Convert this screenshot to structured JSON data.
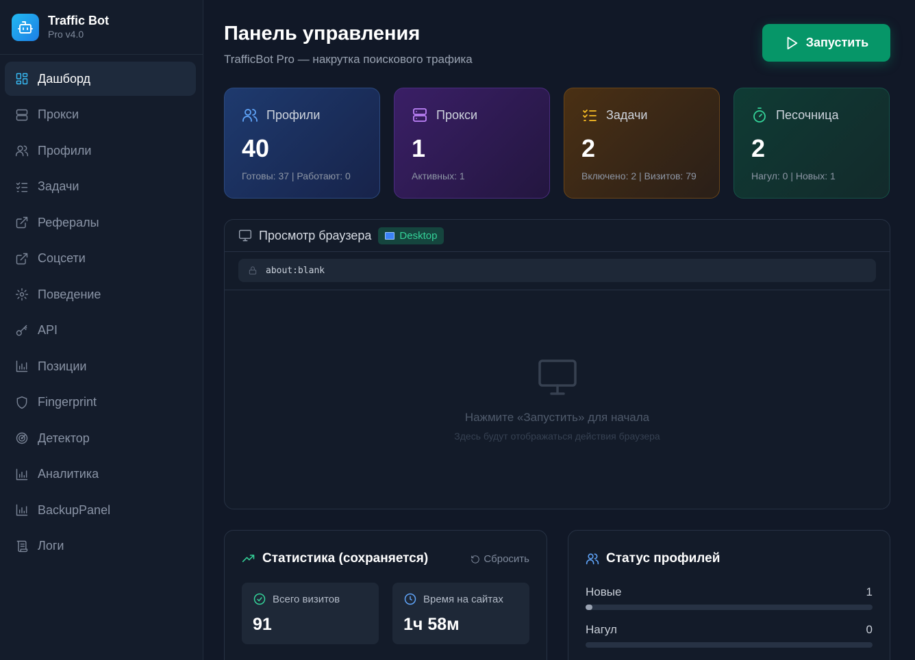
{
  "brand": {
    "title": "Traffic Bot",
    "subtitle": "Pro v4.0"
  },
  "sidebar": {
    "items": [
      {
        "label": "Дашборд",
        "icon": "dashboard-icon",
        "active": true
      },
      {
        "label": "Прокси",
        "icon": "server-icon"
      },
      {
        "label": "Профили",
        "icon": "users-icon"
      },
      {
        "label": "Задачи",
        "icon": "list-checks-icon"
      },
      {
        "label": "Рефералы",
        "icon": "external-link-icon"
      },
      {
        "label": "Соцсети",
        "icon": "external-link-icon"
      },
      {
        "label": "Поведение",
        "icon": "gear-icon"
      },
      {
        "label": "API",
        "icon": "key-icon"
      },
      {
        "label": "Позиции",
        "icon": "bar-chart-icon"
      },
      {
        "label": "Fingerprint",
        "icon": "shield-icon"
      },
      {
        "label": "Детектор",
        "icon": "radar-icon"
      },
      {
        "label": "Аналитика",
        "icon": "bar-chart-icon"
      },
      {
        "label": "BackupPanel",
        "icon": "bar-chart-icon"
      },
      {
        "label": "Логи",
        "icon": "scroll-icon"
      }
    ]
  },
  "header": {
    "title": "Панель управления",
    "subtitle": "TrafficBot Pro — накрутка поискового трафика",
    "start_label": "Запустить"
  },
  "cards": [
    {
      "label": "Профили",
      "value": "40",
      "footer": "Готовы: 37 | Работают: 0",
      "icon": "users-icon",
      "color": "#60a5fa"
    },
    {
      "label": "Прокси",
      "value": "1",
      "footer": "Активных: 1",
      "icon": "server-icon",
      "color": "#c084fc"
    },
    {
      "label": "Задачи",
      "value": "2",
      "footer": "Включено: 2 | Визитов: 79",
      "icon": "list-checks-icon",
      "color": "#fbbf24"
    },
    {
      "label": "Песочница",
      "value": "2",
      "footer": "Нагул: 0 | Новых: 1",
      "icon": "timer-icon",
      "color": "#34d399"
    }
  ],
  "browser": {
    "title": "Просмотр браузера",
    "mode": "Desktop",
    "url": "about:blank",
    "empty_title": "Нажмите «Запустить» для начала",
    "empty_sub": "Здесь будут отображаться действия браузера"
  },
  "stats": {
    "title": "Статистика (сохраняется)",
    "reset_label": "Сбросить",
    "boxes": [
      {
        "label": "Всего визитов",
        "value": "91",
        "icon": "check-circle-icon",
        "color": "#34d399"
      },
      {
        "label": "Время на сайтах",
        "value": "1ч 58м",
        "icon": "clock-icon",
        "color": "#60a5fa"
      }
    ]
  },
  "profile_status": {
    "title": "Статус профилей",
    "rows": [
      {
        "label": "Новые",
        "count": "1",
        "fraction": 0.025
      },
      {
        "label": "Нагул",
        "count": "0",
        "fraction": 0
      }
    ]
  }
}
